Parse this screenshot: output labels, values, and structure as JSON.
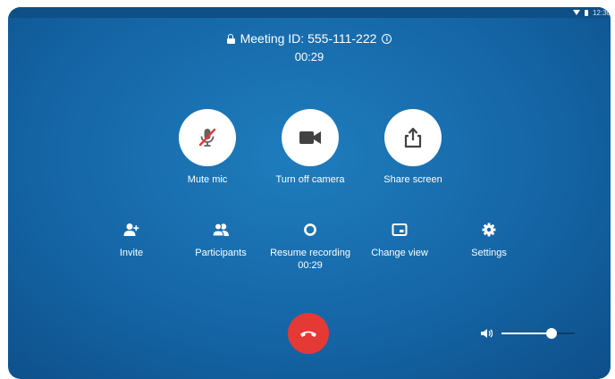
{
  "status_bar": {
    "time": "12:30"
  },
  "meeting": {
    "id_text": "Meeting ID: 555-111-222",
    "elapsed": "00:29"
  },
  "main_controls": [
    {
      "label": "Mute mic",
      "icon": "mic-off-icon"
    },
    {
      "label": "Turn off camera",
      "icon": "video-camera-icon"
    },
    {
      "label": "Share screen",
      "icon": "share-screen-icon"
    }
  ],
  "secondary_controls": [
    {
      "label": "Invite",
      "icon": "person-add-icon"
    },
    {
      "label": "Participants",
      "icon": "people-icon"
    },
    {
      "label": "Resume recording",
      "sublabel": "00:29",
      "icon": "record-icon"
    },
    {
      "label": "Change view",
      "icon": "change-view-icon"
    },
    {
      "label": "Settings",
      "icon": "gear-icon"
    }
  ],
  "end_call": {
    "icon": "hang-up-icon",
    "color": "#e53935"
  },
  "volume": {
    "level": 0.68,
    "icon": "speaker-icon"
  },
  "colors": {
    "background": "#1566a6",
    "end_call": "#e53935",
    "accent_red": "#e53935"
  }
}
